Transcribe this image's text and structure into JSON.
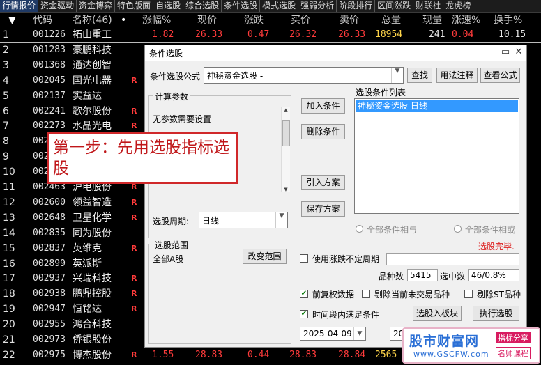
{
  "tabs": [
    "行情报价",
    "资金驱动",
    "资金博弈",
    "特色版面",
    "自选股",
    "综合选股",
    "条件选股",
    "模式选股",
    "强弱分析",
    "阶段排行",
    "区间涨跌",
    "财联社",
    "龙虎榜"
  ],
  "columns": [
    "代码",
    "名称(46)",
    "涨幅%",
    "现价",
    "涨跌",
    "买价",
    "卖价",
    "总量",
    "现量",
    "涨速%",
    "换手%"
  ],
  "sort_marker": "•",
  "rows": [
    {
      "n": "1",
      "code": "001226",
      "name": "拓山重工",
      "r": "",
      "chg": "1.82",
      "price": "26.33",
      "diff": "0.47",
      "bid": "26.32",
      "ask": "26.33",
      "vol": "18954",
      "cur": "241",
      "spd": "0.04",
      "turn": "10.15"
    },
    {
      "n": "2",
      "code": "001283",
      "name": "豪鹏科技",
      "r": ""
    },
    {
      "n": "3",
      "code": "001368",
      "name": "通达创智",
      "r": ""
    },
    {
      "n": "4",
      "code": "002045",
      "name": "国光电器",
      "r": "R"
    },
    {
      "n": "5",
      "code": "002137",
      "name": "实益达",
      "r": ""
    },
    {
      "n": "6",
      "code": "002241",
      "name": "歌尔股份",
      "r": "R"
    },
    {
      "n": "7",
      "code": "002273",
      "name": "水晶光电",
      "r": "R"
    },
    {
      "n": "8",
      "code": "002",
      "name": "",
      "r": ""
    },
    {
      "n": "9",
      "code": "002",
      "name": "",
      "r": ""
    },
    {
      "n": "10",
      "code": "002",
      "name": "",
      "r": ""
    },
    {
      "n": "11",
      "code": "002463",
      "name": "沪电股份",
      "r": "R"
    },
    {
      "n": "12",
      "code": "002600",
      "name": "领益智造",
      "r": "R"
    },
    {
      "n": "13",
      "code": "002648",
      "name": "卫星化学",
      "r": "R"
    },
    {
      "n": "14",
      "code": "002835",
      "name": "同为股份",
      "r": ""
    },
    {
      "n": "15",
      "code": "002837",
      "name": "英维克",
      "r": "R"
    },
    {
      "n": "16",
      "code": "002899",
      "name": "英派斯",
      "r": ""
    },
    {
      "n": "17",
      "code": "002937",
      "name": "兴瑞科技",
      "r": "R"
    },
    {
      "n": "18",
      "code": "002938",
      "name": "鹏鼎控股",
      "r": "R"
    },
    {
      "n": "19",
      "code": "002947",
      "name": "恒铭达",
      "r": "R"
    },
    {
      "n": "20",
      "code": "002955",
      "name": "鸿合科技",
      "r": ""
    },
    {
      "n": "21",
      "code": "002973",
      "name": "侨银股份",
      "r": ""
    },
    {
      "n": "22",
      "code": "002975",
      "name": "博杰股份",
      "r": "R",
      "chg": "1.55",
      "price": "28.83",
      "diff": "0.44",
      "bid": "28.83",
      "ask": "28.84",
      "vol": "2565"
    }
  ],
  "dialog": {
    "title": "条件选股",
    "formula_label": "条件选股公式",
    "formula_value": "神秘资金选股  -",
    "btn_find": "查找",
    "btn_usage": "用法注释",
    "btn_view": "查看公式",
    "params_title": "计算参数",
    "params_text": "无参数需要设置",
    "btn_add": "加入条件",
    "btn_delete": "删除条件",
    "btn_import": "引入方案",
    "btn_save": "保存方案",
    "list_title": "选股条件列表",
    "list_items": [
      "神秘资金选股  日线"
    ],
    "radio_and": "全部条件相与",
    "radio_or": "全部条件相或",
    "status": "选股完毕.",
    "period_label": "选股周期:",
    "period_value": "日线",
    "range_title": "选股范围",
    "range_value": "全部A股",
    "btn_range": "改变范围",
    "chk_irregular": "使用涨跌不定周期",
    "count_label": "品种数",
    "count_value": "5415",
    "selected_label": "选中数",
    "selected_value": "46/0.8%",
    "chk_adjust": "前复权数据",
    "chk_exclude_untraded": "剔除当前未交易品种",
    "chk_exclude_st": "剔除ST品种",
    "chk_period": "时间段内满足条件",
    "btn_to_board": "选股入板块",
    "btn_execute": "执行选股",
    "date_from": "2025-04-09",
    "date_sep": "-",
    "date_to": "20"
  },
  "callout": {
    "text": "第一步：先用选股指标选股"
  },
  "watermark": {
    "brand": "股市财富网",
    "url": "www.GSCFW.com",
    "tag1": "指标分享",
    "tag2": "名师课程"
  },
  "colors": {
    "up": "#ff3b3b",
    "volume": "#ffd54a",
    "callout": "#d0282a",
    "selection": "#3399ff"
  }
}
